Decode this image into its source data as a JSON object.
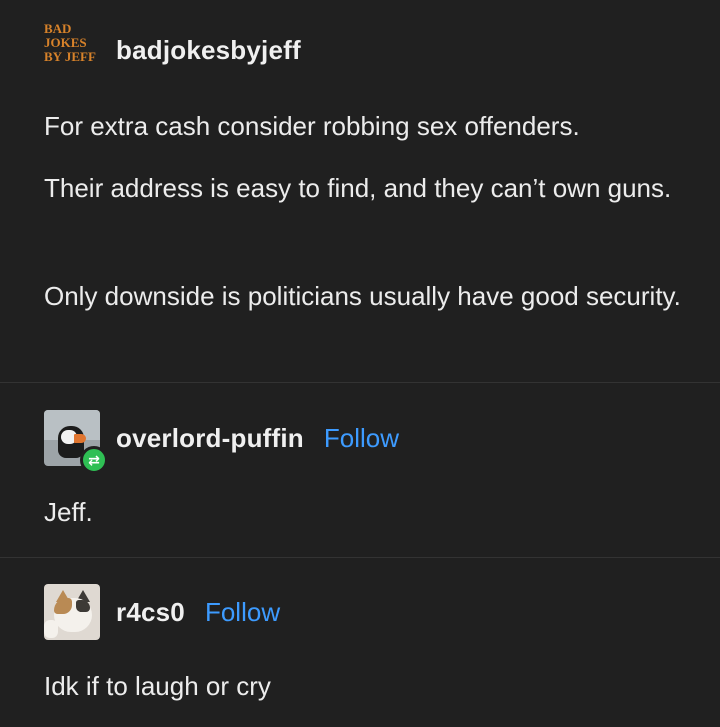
{
  "posts": [
    {
      "username": "badjokesbyjeff",
      "avatar_icon": "bad-jokes-by-jeff-logo",
      "logo_lines": [
        "BAD",
        "JOKES",
        "BY JEFF"
      ],
      "paragraphs": [
        "For extra cash consider robbing sex offenders.",
        "Their address is easy to find, and they can’t own guns.",
        "Only downside is politicians usually have good security."
      ]
    },
    {
      "username": "overlord-puffin",
      "follow_label": "Follow",
      "avatar_icon": "puffin-avatar",
      "badge_icon": "reblog-icon",
      "paragraphs": [
        "Jeff."
      ]
    },
    {
      "username": "r4cs0",
      "follow_label": "Follow",
      "avatar_icon": "cat-avatar",
      "paragraphs": [
        "Idk if to laugh or cry"
      ]
    }
  ],
  "colors": {
    "background": "#202020",
    "follow": "#3d9bff",
    "logo": "#d7822a",
    "reblog_badge": "#2fbf54"
  }
}
